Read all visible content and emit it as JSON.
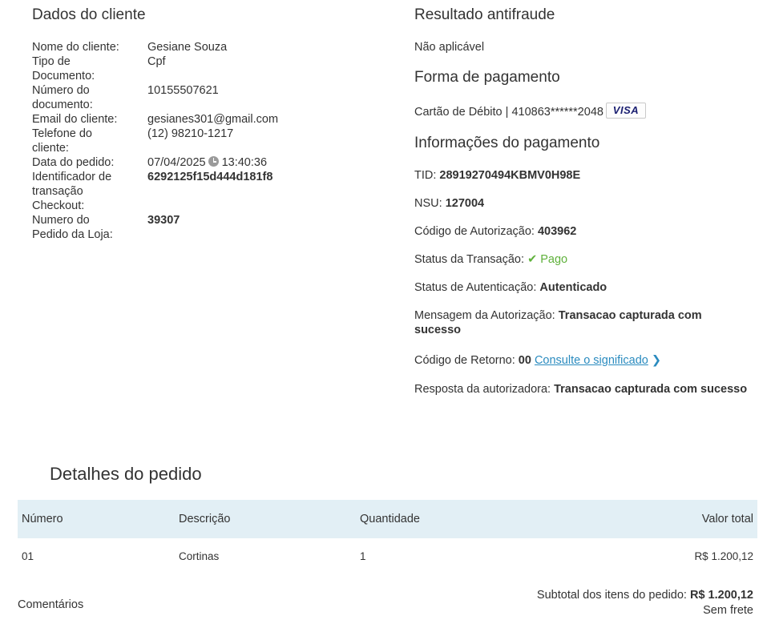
{
  "client": {
    "title": "Dados do cliente",
    "name_label": "Nome do cliente:",
    "name": "Gesiane Souza",
    "doc_type_label_1": "Tipo de",
    "doc_type_label_2": "Documento:",
    "doc_type": "Cpf",
    "doc_number_label_1": "Número do",
    "doc_number_label_2": "documento:",
    "doc_number": "10155507621",
    "email_label": "Email do cliente:",
    "email": "gesianes301@gmail.com",
    "phone_label_1": "Telefone do",
    "phone_label_2": "cliente:",
    "phone": "(12) 98210-1217",
    "order_date_label": "Data do pedido:",
    "order_date": "07/04/2025",
    "order_time": "13:40:36",
    "transaction_id_label_1": "Identificador de",
    "transaction_id_label_2": "transação",
    "transaction_id_label_3": "Checkout:",
    "transaction_id": "6292125f15d444d181f8",
    "store_order_label_1": "Numero do",
    "store_order_label_2": "Pedido da Loja:",
    "store_order": "39307"
  },
  "antifraud": {
    "title": "Resultado antifraude",
    "value": "Não aplicável"
  },
  "payment_method": {
    "title": "Forma de pagamento",
    "value": "Cartão de Débito | 410863******2048",
    "card_brand": "VISA"
  },
  "payment_info": {
    "title": "Informações do pagamento",
    "tid_label": "TID:",
    "tid": "28919270494KBMV0H98E",
    "nsu_label": "NSU:",
    "nsu": "127004",
    "auth_code_label": "Código de Autorização:",
    "auth_code": "403962",
    "status_label": "Status da Transação:",
    "status": "Pago",
    "status_color": "#5fb13b",
    "auth_status_label": "Status de Autenticação:",
    "auth_status": "Autenticado",
    "auth_message_label": "Mensagem da Autorização:",
    "auth_message": "Transacao capturada com sucesso",
    "return_code_label": "Código de Retorno:",
    "return_code": "00",
    "return_code_link": "Consulte o significado",
    "authorizer_response_label": "Resposta da autorizadora:",
    "authorizer_response": "Transacao capturada com sucesso"
  },
  "order": {
    "title": "Detalhes do pedido",
    "columns": [
      "Número",
      "Descrição",
      "Quantidade",
      "Valor total"
    ],
    "rows": [
      {
        "number": "01",
        "description": "Cortinas",
        "quantity": "1",
        "total": "R$ 1.200,12"
      }
    ],
    "comments_label": "Comentários",
    "subtotal_label": "Subtotal dos itens do pedido:",
    "subtotal": "R$ 1.200,12",
    "shipping": "Sem frete"
  }
}
